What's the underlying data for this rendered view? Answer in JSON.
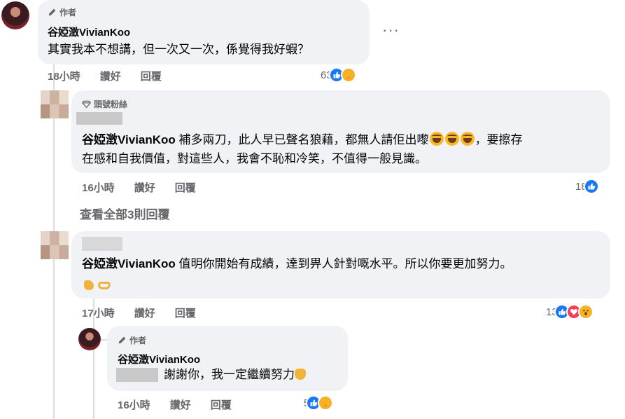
{
  "comment1": {
    "badge": "作者",
    "name": "谷婭澂VivianKoo",
    "text": "其實我本不想講，但一次又一次，係覺得我好蝦？",
    "time": "18小時",
    "like": "讚好",
    "reply": "回覆",
    "react_count": "63",
    "more": "···"
  },
  "comment2": {
    "badge": "頭號粉絲",
    "mention": "谷婭澂VivianKoo",
    "text_line1": " 補多兩刀，此人早已聲名狼藉，都無人請佢出嚟",
    "text_line1_tail": "，要擦存",
    "text_line2": "在感和自我價值，對這些人，我會不恥和冷笑，不值得一般見識。",
    "time": "16小時",
    "like": "讚好",
    "reply": "回覆",
    "react_count": "18"
  },
  "see_all": "查看全部3則回覆",
  "comment3": {
    "mention": "谷婭澂VivianKoo",
    "text": " 值明你開始有成績，達到畀人針對嘅水平。所以你要更加努力。",
    "time": "17小時",
    "like": "讚好",
    "reply": "回覆",
    "react_count": "13"
  },
  "comment4": {
    "badge": "作者",
    "name": "谷婭澂VivianKoo",
    "text": "謝謝你，我一定繼續努力",
    "time": "16小時",
    "like": "讚好",
    "reply": "回覆",
    "react_count": "5"
  },
  "colors": {
    "like": "#1877f2",
    "bubble": "#f0f2f5",
    "meta": "#65676b"
  }
}
